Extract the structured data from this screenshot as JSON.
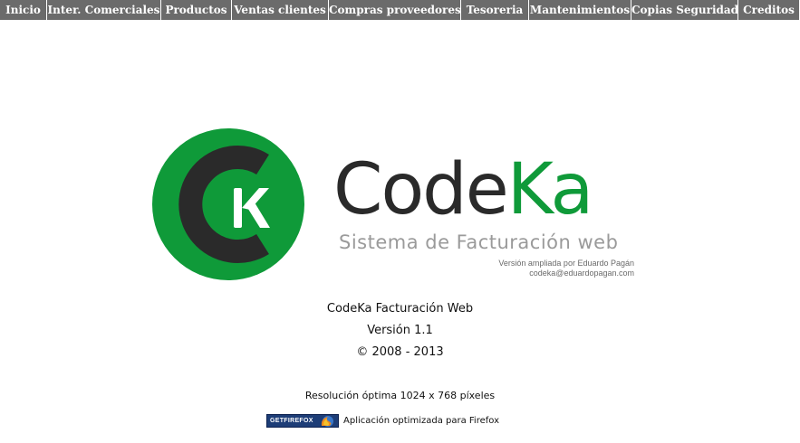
{
  "menu": {
    "items": [
      {
        "label": "Inicio"
      },
      {
        "label": "Inter. Comerciales"
      },
      {
        "label": "Productos"
      },
      {
        "label": "Ventas clientes"
      },
      {
        "label": "Compras proveedores"
      },
      {
        "label": "Tesoreria"
      },
      {
        "label": "Mantenimientos"
      },
      {
        "label": "Copias Seguridad"
      },
      {
        "label": "Creditos"
      }
    ]
  },
  "logo": {
    "mark_icon": "codeka-ck-logo-icon",
    "brand_first": "Code",
    "brand_second": "Ka",
    "tagline": "Sistema de Facturación web",
    "credit_line1": "Versión ampliada por Eduardo Pagán",
    "credit_line2": "codeka@eduardopagan.com",
    "colors": {
      "green": "#0f9a39",
      "dark": "#2a2a2a",
      "gray": "#9a9a9a"
    }
  },
  "info": {
    "title": "CodeKa Facturación Web",
    "version": "Versión 1.1",
    "copyright": "© 2008 - 2013",
    "resolution": "Resolución óptima 1024 x 768 píxeles"
  },
  "firefox": {
    "badge_text": "GETFIREFOX",
    "caption": "Aplicación optimizada para Firefox",
    "icon": "firefox-icon"
  },
  "colors": {
    "menu_bg": "#6b6b6b",
    "menu_text": "#ffffff"
  }
}
